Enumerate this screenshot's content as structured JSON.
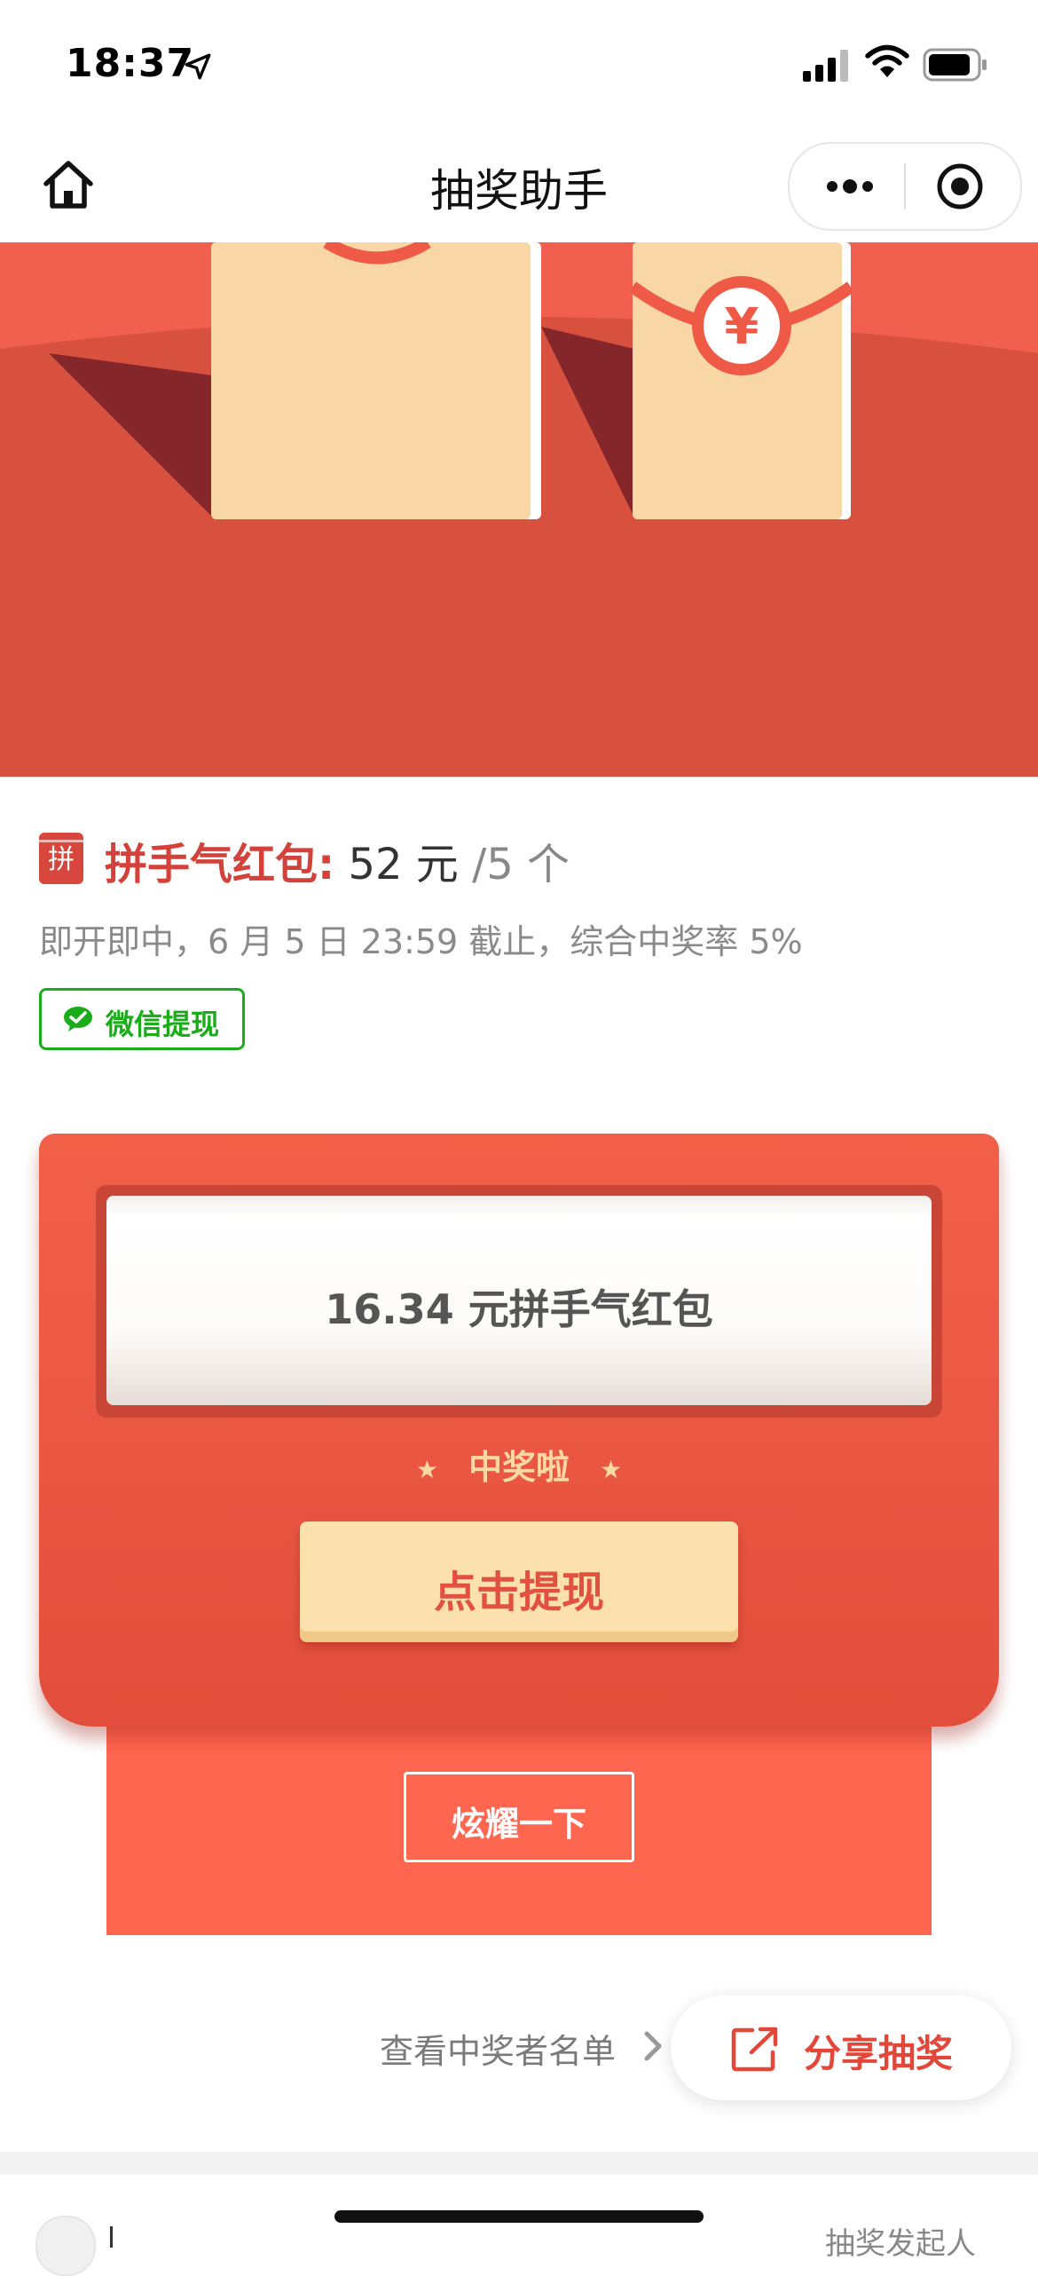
{
  "status_bar": {
    "time": "18:37"
  },
  "nav": {
    "title": "抽奖助手"
  },
  "prize": {
    "badge": "拼",
    "label": "拼手气红包:",
    "amount": " 52 元 ",
    "count": "/5 个",
    "sub_info": "即开即中，6 月 5 日 23:59 截止，综合中奖率 5%",
    "withdraw_tag": "微信提现"
  },
  "result_card": {
    "result_text": "16.34 元拼手气红包",
    "star_left": "★",
    "win_text": "中奖啦",
    "star_right": "★",
    "withdraw_button": "点击提现",
    "show_off_button": "炫耀一下"
  },
  "footer": {
    "winner_list_link": "查看中奖者名单",
    "share_button": "分享抽奖",
    "initiator_label": "抽奖发起人"
  },
  "colors": {
    "accent_red": "#d3413a",
    "card_red": "#f26049",
    "wechat_green": "#1aad19",
    "withdraw_button_bg": "#fce0ae"
  },
  "icons": [
    "location-arrow-icon",
    "signal-icon",
    "wifi-icon",
    "battery-icon",
    "home-icon",
    "more-dots-icon",
    "target-icon",
    "yuan-icon",
    "wechat-icon",
    "chevron-right-icon",
    "share-icon",
    "avatar-icon"
  ]
}
